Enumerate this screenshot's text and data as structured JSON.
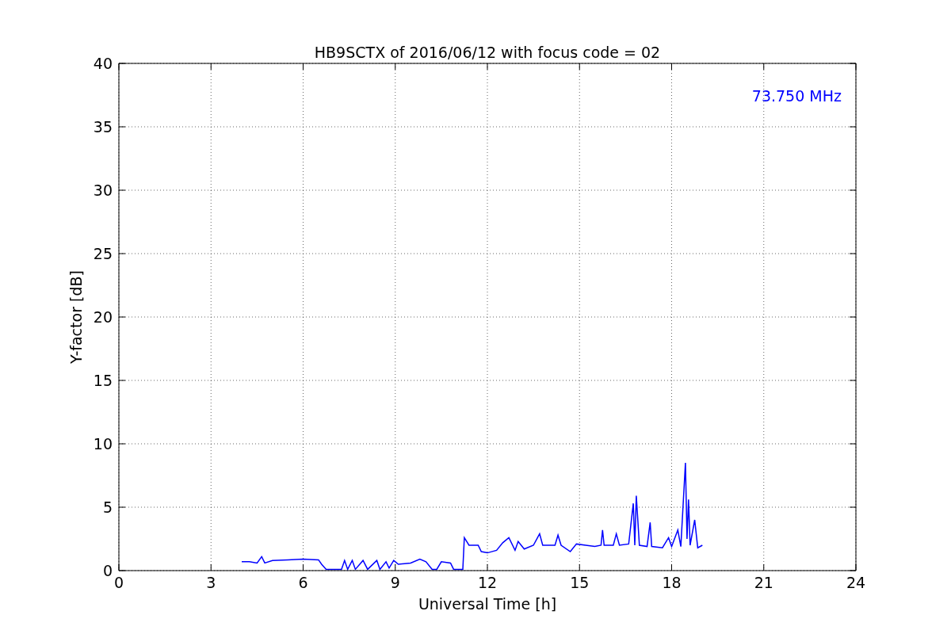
{
  "chart": {
    "chart_data": {
      "type": "line",
      "title": "HB9SCTX of 2016/06/12 with focus code = 02",
      "xlabel": "Universal Time [h]",
      "ylabel": "Y-factor [dB]",
      "xlim": [
        0,
        24
      ],
      "ylim": [
        0,
        40
      ],
      "xticks": [
        0,
        3,
        6,
        9,
        12,
        15,
        18,
        21,
        24
      ],
      "yticks": [
        0,
        5,
        10,
        15,
        20,
        25,
        30,
        35,
        40
      ],
      "x": [
        4.0,
        4.25,
        4.5,
        4.65,
        4.75,
        5.0,
        5.5,
        6.0,
        6.5,
        6.6,
        6.75,
        7.0,
        7.25,
        7.35,
        7.45,
        7.6,
        7.7,
        7.95,
        8.1,
        8.4,
        8.5,
        8.7,
        8.8,
        8.95,
        9.1,
        9.5,
        9.8,
        10.0,
        10.2,
        10.35,
        10.5,
        10.8,
        10.9,
        11.2,
        11.25,
        11.4,
        11.7,
        11.8,
        12.0,
        12.3,
        12.5,
        12.7,
        12.9,
        13.0,
        13.2,
        13.5,
        13.7,
        13.8,
        14.2,
        14.3,
        14.4,
        14.7,
        14.9,
        15.2,
        15.5,
        15.7,
        15.75,
        15.8,
        16.1,
        16.2,
        16.3,
        16.6,
        16.75,
        16.8,
        16.85,
        16.95,
        17.2,
        17.3,
        17.35,
        17.7,
        17.9,
        18.0,
        18.2,
        18.3,
        18.45,
        18.5,
        18.55,
        18.6,
        18.75,
        18.85,
        19.0
      ],
      "grid": true,
      "series": [
        {
          "name": "73.750 MHz",
          "color": "#0000ff",
          "values": [
            0.7,
            0.7,
            0.6,
            1.1,
            0.6,
            0.8,
            0.85,
            0.9,
            0.85,
            0.5,
            0.1,
            0.1,
            0.1,
            0.8,
            0.1,
            0.8,
            0.1,
            0.8,
            0.1,
            0.8,
            0.1,
            0.7,
            0.2,
            0.8,
            0.5,
            0.6,
            0.9,
            0.7,
            0.1,
            0.1,
            0.7,
            0.6,
            0.1,
            0.1,
            2.6,
            2.0,
            2.0,
            1.5,
            1.4,
            1.6,
            2.2,
            2.6,
            1.6,
            2.3,
            1.7,
            2.0,
            2.9,
            2.0,
            2.0,
            2.8,
            2.0,
            1.5,
            2.1,
            2.0,
            1.9,
            2.0,
            3.2,
            2.0,
            2.0,
            2.9,
            2.0,
            2.1,
            5.3,
            2.0,
            5.9,
            2.0,
            1.9,
            3.8,
            1.9,
            1.8,
            2.6,
            1.9,
            3.2,
            1.9,
            8.5,
            2.5,
            5.6,
            2.0,
            4.0,
            1.8,
            2.0
          ]
        }
      ]
    }
  }
}
